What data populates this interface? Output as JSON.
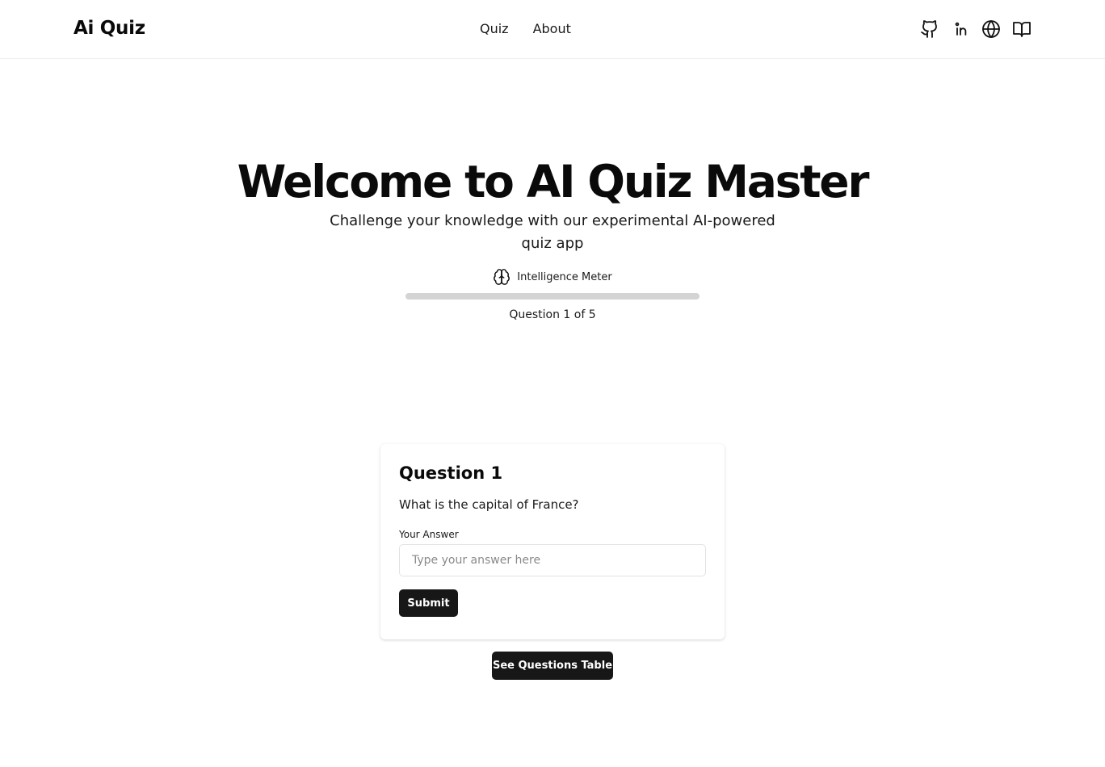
{
  "header": {
    "brand": "Ai Quiz",
    "nav": [
      {
        "label": "Quiz"
      },
      {
        "label": "About"
      }
    ],
    "icons": [
      "github-icon",
      "linkedin-icon",
      "globe-icon",
      "book-open-icon"
    ]
  },
  "hero": {
    "title": "Welcome to AI Quiz Master",
    "subtitle": "Challenge your knowledge with our experimental AI-powered quiz app",
    "meter_label": "Intelligence Meter",
    "meter_icon": "brain-icon",
    "progress_fraction": 0,
    "counter": "Question 1 of 5"
  },
  "card": {
    "title": "Question 1",
    "question": "What is the capital of France?",
    "answer_label": "Your Answer",
    "answer_placeholder": "Type your answer here",
    "answer_value": "",
    "submit_label": "Submit"
  },
  "questions_table_button": "See Questions Table",
  "colors": {
    "primary": "#171717",
    "track": "#d4d4d4",
    "background": "#ffffff"
  }
}
